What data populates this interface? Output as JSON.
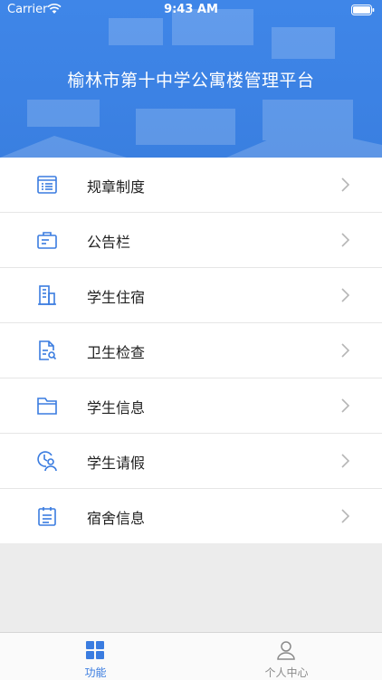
{
  "status_bar": {
    "carrier": "Carrier",
    "time": "9:43 AM"
  },
  "header": {
    "title": "榆林市第十中学公寓楼管理平台"
  },
  "menu": [
    {
      "label": "规章制度",
      "icon": "regulations-list-icon"
    },
    {
      "label": "公告栏",
      "icon": "bulletin-board-icon"
    },
    {
      "label": "学生住宿",
      "icon": "building-icon"
    },
    {
      "label": "卫生检查",
      "icon": "inspection-document-icon"
    },
    {
      "label": "学生信息",
      "icon": "folder-icon"
    },
    {
      "label": "学生请假",
      "icon": "person-clock-icon"
    },
    {
      "label": "宿舍信息",
      "icon": "clipboard-icon"
    }
  ],
  "tabbar": {
    "tabs": [
      {
        "label": "功能",
        "active": true
      },
      {
        "label": "个人中心",
        "active": false
      }
    ]
  },
  "colors": {
    "accent": "#3a7ce0",
    "header": "#3c82e4",
    "inactive": "#8a8a8a"
  }
}
